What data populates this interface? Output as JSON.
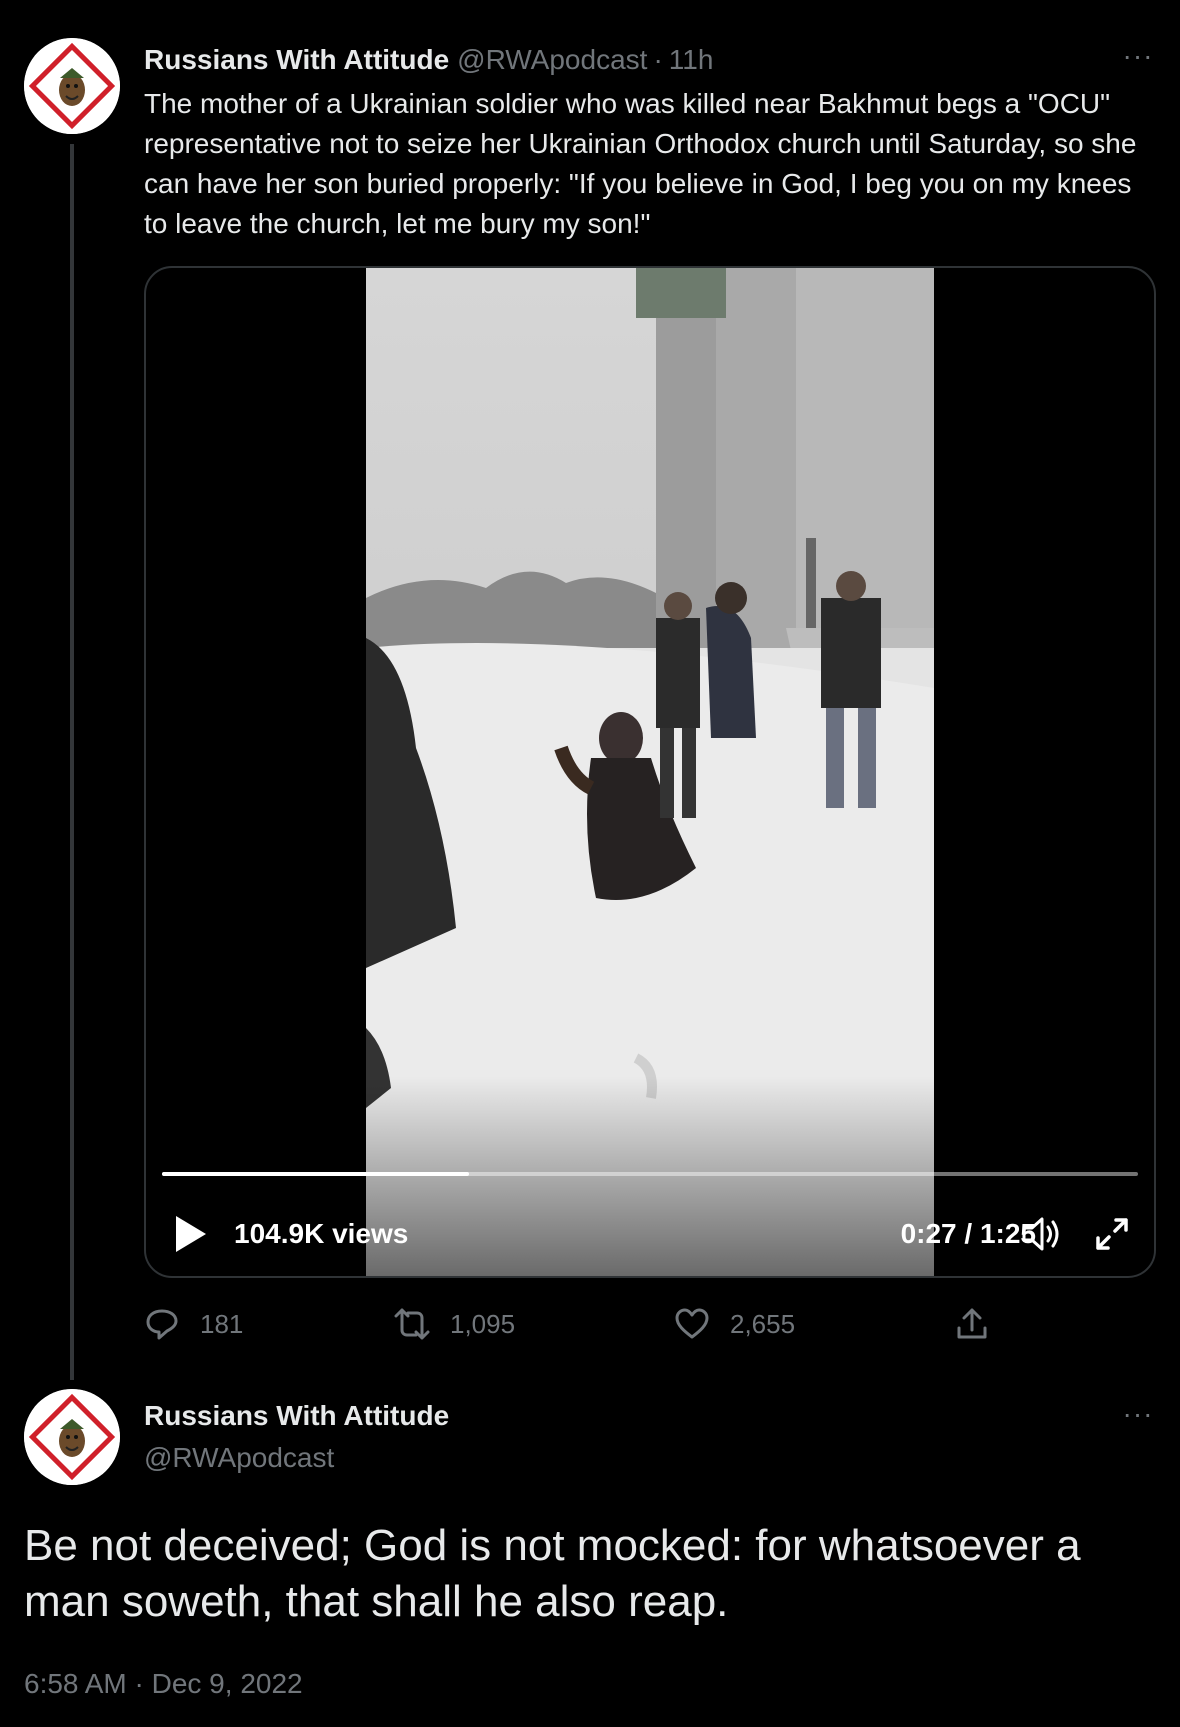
{
  "tweet1": {
    "display_name": "Russians With Attitude",
    "handle": "@RWApodcast",
    "separator": "·",
    "time": "11h",
    "more": "···",
    "text": "The mother of a Ukrainian soldier who was killed near Bakhmut begs a \"OCU\" representative not to seize her Ukrainian Orthodox church until Saturday, so she can have her son buried properly: \"If you believe in God, I beg you on my knees to leave the church, let me bury my son!\"",
    "video": {
      "views": "104.9K views",
      "timecode": "0:27 / 1:25",
      "progress": 0.315
    },
    "actions": {
      "replies": "181",
      "retweets": "1,095",
      "likes": "2,655"
    }
  },
  "tweet2": {
    "display_name": "Russians With Attitude",
    "handle": "@RWApodcast",
    "more": "···",
    "text": "Be not deceived; God is not mocked: for whatsoever a man soweth, that shall he also reap.",
    "timestamp": "6:58 AM · Dec 9, 2022"
  },
  "colors": {
    "background": "#000000",
    "text_primary": "#e7e9ea",
    "text_secondary": "#71767b",
    "border": "#2f3336",
    "avatar_accent": "#d0202a"
  },
  "icons": [
    "reply-icon",
    "retweet-icon",
    "like-icon",
    "share-icon",
    "play-icon",
    "volume-icon",
    "fullscreen-icon",
    "more-icon"
  ]
}
